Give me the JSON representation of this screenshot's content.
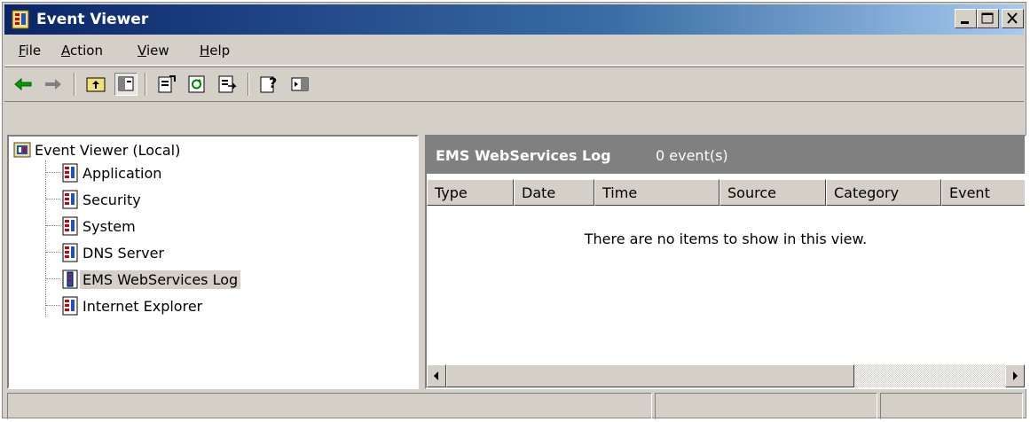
{
  "window": {
    "title": "Event Viewer"
  },
  "menu": {
    "file": "File",
    "action": "Action",
    "view": "View",
    "help": "Help"
  },
  "toolbar": {
    "icons": [
      "back-icon",
      "forward-icon",
      "up-icon",
      "show-hide-tree-icon",
      "properties-icon",
      "refresh-icon",
      "export-list-icon",
      "help-icon",
      "show-hide-action-pane-icon"
    ]
  },
  "tree": {
    "root": "Event Viewer (Local)",
    "items": [
      "Application",
      "Security",
      "System",
      "DNS Server",
      "EMS WebServices Log",
      "Internet Explorer"
    ],
    "selected": "EMS WebServices Log"
  },
  "detail": {
    "log_name": "EMS WebServices Log",
    "event_count": "0 event(s)",
    "columns": [
      "Type",
      "Date",
      "Time",
      "Source",
      "Category",
      "Event"
    ],
    "empty_message": "There are no items to show in this view."
  },
  "colors": {
    "titlebar_start": "#0a246a",
    "titlebar_end": "#a6caf0",
    "face": "#d4d0c8",
    "header_gray": "#808080"
  }
}
